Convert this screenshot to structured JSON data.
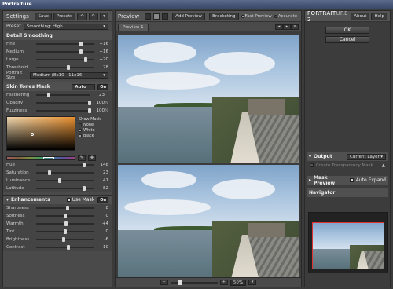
{
  "window": {
    "title": "Portraiture"
  },
  "left": {
    "title": "Settings",
    "buttons": {
      "save": "Save",
      "presets": "Presets"
    },
    "preset_label": "Preset",
    "preset_value": "Smoothing: High",
    "detail": {
      "title": "Detail Smoothing",
      "rows": [
        {
          "label": "Fine",
          "value": "+16",
          "pos": 0.77
        },
        {
          "label": "Medium",
          "value": "+16",
          "pos": 0.77
        },
        {
          "label": "Large",
          "value": "+20",
          "pos": 0.85
        },
        {
          "label": "Threshold",
          "value": "28",
          "pos": 0.55
        }
      ],
      "portrait_size_label": "Portrait Size",
      "portrait_size_value": "Medium (8x10 - 11x16)"
    },
    "skin": {
      "title": "Skin Tones Mask",
      "mode": "Auto",
      "on": "On",
      "rows": [
        {
          "label": "Feathering",
          "value": "23",
          "unit": "",
          "pos": 0.23
        },
        {
          "label": "Opacity",
          "value": "100",
          "unit": "%",
          "pos": 0.98
        },
        {
          "label": "Fuzziness",
          "value": "100",
          "unit": "%",
          "pos": 0.98
        }
      ],
      "show_mask_label": "Show Mask",
      "show_mask_options": [
        "None",
        "White",
        "Black"
      ],
      "hsl": [
        {
          "label": "Hue",
          "value": "148",
          "pos": 0.82
        },
        {
          "label": "Saturation",
          "value": "23",
          "pos": 0.23
        },
        {
          "label": "Luminance",
          "value": "41",
          "pos": 0.41
        },
        {
          "label": "Latitude",
          "value": "82",
          "pos": 0.82
        }
      ]
    },
    "enh": {
      "title": "Enhancements",
      "use_mask": "Use Mask",
      "on": "On",
      "rows": [
        {
          "label": "Sharpness",
          "value": "8",
          "pos": 0.54
        },
        {
          "label": "Softness",
          "value": "0",
          "pos": 0.5
        },
        {
          "label": "Warmth",
          "value": "+4",
          "pos": 0.52
        },
        {
          "label": "Tint",
          "value": "0",
          "pos": 0.5
        },
        {
          "label": "Brightness",
          "value": "-6",
          "pos": 0.47
        },
        {
          "label": "Contrast",
          "value": "+10",
          "pos": 0.55
        }
      ]
    }
  },
  "center": {
    "title": "Preview",
    "add_preview": "Add Preview",
    "bracketing": "Bracketing",
    "fast_preview": "Fast Preview",
    "accurate": "Accurate",
    "tab": "Preview 1",
    "zoom": "50%"
  },
  "right": {
    "logo_a": "PORTRAIT",
    "logo_b": "URE",
    "logo_ver": "2",
    "about": "About",
    "help": "Help",
    "ok": "OK",
    "cancel": "Cancel",
    "output_label": "Output",
    "output_value": "Current Layer",
    "create_mask": "Create Transparency Mask",
    "mask_preview": "Mask Preview",
    "auto_expand": "Auto Expand",
    "navigator": "Navigator"
  }
}
